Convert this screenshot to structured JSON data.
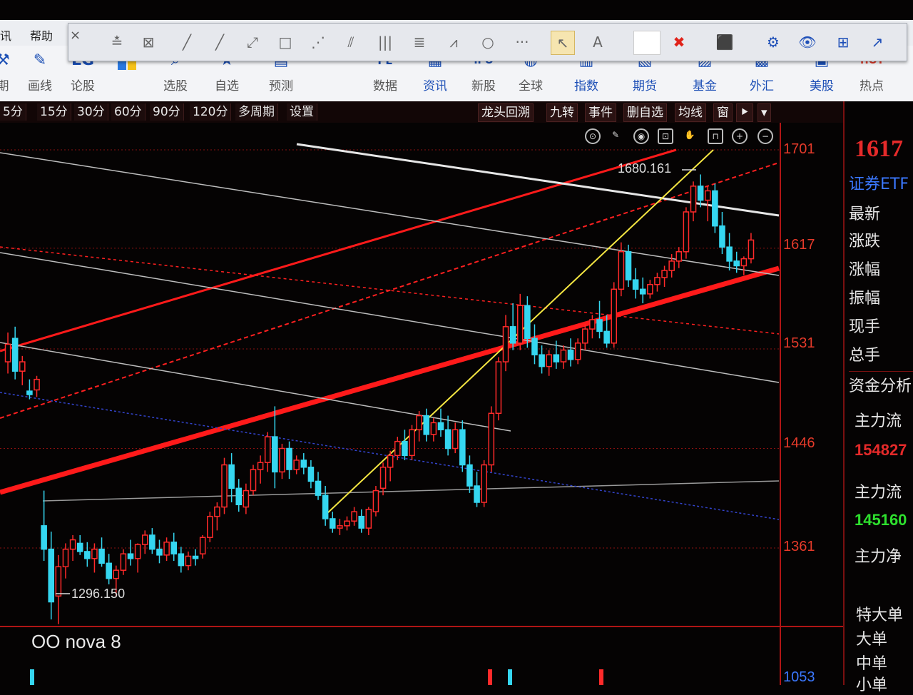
{
  "menubar": {
    "items": [
      "讯",
      "帮助"
    ]
  },
  "toolbar": {
    "buttons": [
      {
        "label": "期",
        "icon": "wrench-icon"
      },
      {
        "label": "画线",
        "icon": "pencil-icon"
      },
      {
        "label": "论股",
        "icon": "lg-logo-icon"
      },
      {
        "label": "",
        "icon": "windows-logo-icon"
      },
      {
        "label": "选股",
        "icon": "magnifier-icon"
      },
      {
        "label": "自选",
        "icon": "star-icon"
      },
      {
        "label": "预测",
        "icon": "forecast-icon"
      },
      {
        "label": "数据",
        "icon": "pe-icon"
      },
      {
        "label": "资讯",
        "icon": "news-icon"
      },
      {
        "label": "新股",
        "icon": "ipo-icon"
      },
      {
        "label": "全球",
        "icon": "globe-icon"
      },
      {
        "label": "指数",
        "icon": "index-icon"
      },
      {
        "label": "期货",
        "icon": "futures-icon"
      },
      {
        "label": "基金",
        "icon": "fund-icon"
      },
      {
        "label": "外汇",
        "icon": "forex-icon"
      },
      {
        "label": "美股",
        "icon": "us-stock-icon"
      },
      {
        "label": "热点",
        "icon": "hot-icon"
      }
    ]
  },
  "drawbar": {
    "close_label": "×",
    "tools": [
      "≛",
      "⊠",
      "╱",
      "╱",
      "⤢",
      "□",
      "⋰",
      "⫽",
      "|||",
      "≣",
      "⩘",
      "○",
      "···"
    ],
    "right_tools": [
      "↖",
      "A",
      "",
      "✖",
      "⬛",
      "⚙",
      "👁",
      "⊞",
      "↗"
    ]
  },
  "periods": [
    "5分",
    "15分",
    "30分",
    "60分",
    "90分",
    "120分",
    "多周期",
    "设置"
  ],
  "right_tools": [
    "龙头回溯",
    "九转",
    "事件",
    "删自选",
    "均线",
    "窗",
    "⯈",
    "▾"
  ],
  "chart_icons": [
    "⊙",
    "✎",
    "◉",
    "⊡",
    "✋",
    "⊓",
    "+",
    "−"
  ],
  "price_axis": [
    "1701",
    "1617",
    "1531",
    "1446",
    "1361",
    "1053"
  ],
  "annotations": {
    "high": "1680.161",
    "low": "1296.150"
  },
  "right_panel": {
    "price": "1617",
    "name": "证券ETF",
    "rows": [
      "最新",
      "涨跌",
      "涨幅",
      "振幅",
      "现手",
      "总手"
    ],
    "section": "资金分析",
    "flow1_label": "主力流",
    "flow1_value": "154827",
    "flow2_label": "主力流",
    "flow2_value": "145160",
    "flow3_label": "主力净",
    "orders": [
      "特大单",
      "大单",
      "中单",
      "小单"
    ]
  },
  "watermark": "OO nova 8",
  "colors": {
    "up": "#ff2a2a",
    "down": "#35d6f0",
    "trend": "#ff1a1a",
    "yellow": "#f5e642"
  },
  "chart_data": {
    "type": "candlestick",
    "ylim": [
      1040,
      1715
    ],
    "candles": [
      [
        1520,
        1545,
        1510,
        1535
      ],
      [
        1540,
        1550,
        1505,
        1512
      ],
      [
        1512,
        1525,
        1500,
        1520
      ],
      [
        1495,
        1505,
        1488,
        1492
      ],
      [
        1496,
        1508,
        1490,
        1505
      ],
      [
        1380,
        1410,
        1350,
        1360
      ],
      [
        1360,
        1375,
        1300,
        1315
      ],
      [
        1320,
        1355,
        1296,
        1345
      ],
      [
        1345,
        1365,
        1335,
        1360
      ],
      [
        1360,
        1372,
        1350,
        1368
      ],
      [
        1365,
        1372,
        1355,
        1358
      ],
      [
        1358,
        1366,
        1345,
        1352
      ],
      [
        1352,
        1365,
        1340,
        1360
      ],
      [
        1360,
        1370,
        1345,
        1348
      ],
      [
        1348,
        1356,
        1330,
        1335
      ],
      [
        1335,
        1346,
        1320,
        1342
      ],
      [
        1342,
        1360,
        1338,
        1356
      ],
      [
        1356,
        1368,
        1346,
        1352
      ],
      [
        1352,
        1365,
        1340,
        1364
      ],
      [
        1364,
        1376,
        1356,
        1372
      ],
      [
        1372,
        1378,
        1356,
        1360
      ],
      [
        1360,
        1368,
        1348,
        1355
      ],
      [
        1355,
        1370,
        1350,
        1366
      ],
      [
        1366,
        1374,
        1350,
        1356
      ],
      [
        1356,
        1362,
        1340,
        1346
      ],
      [
        1346,
        1358,
        1342,
        1354
      ],
      [
        1354,
        1360,
        1346,
        1352
      ],
      [
        1356,
        1372,
        1352,
        1370
      ],
      [
        1370,
        1392,
        1366,
        1388
      ],
      [
        1388,
        1400,
        1376,
        1396
      ],
      [
        1396,
        1438,
        1390,
        1432
      ],
      [
        1432,
        1442,
        1400,
        1412
      ],
      [
        1412,
        1420,
        1392,
        1398
      ],
      [
        1396,
        1416,
        1390,
        1410
      ],
      [
        1410,
        1432,
        1406,
        1428
      ],
      [
        1428,
        1440,
        1416,
        1434
      ],
      [
        1434,
        1460,
        1426,
        1456
      ],
      [
        1456,
        1482,
        1412,
        1426
      ],
      [
        1426,
        1450,
        1420,
        1446
      ],
      [
        1446,
        1452,
        1420,
        1428
      ],
      [
        1428,
        1440,
        1424,
        1436
      ],
      [
        1436,
        1442,
        1424,
        1430
      ],
      [
        1430,
        1436,
        1412,
        1418
      ],
      [
        1418,
        1426,
        1402,
        1406
      ],
      [
        1406,
        1414,
        1380,
        1386
      ],
      [
        1386,
        1392,
        1374,
        1378
      ],
      [
        1378,
        1386,
        1372,
        1380
      ],
      [
        1380,
        1388,
        1376,
        1384
      ],
      [
        1384,
        1396,
        1380,
        1392
      ],
      [
        1388,
        1394,
        1374,
        1378
      ],
      [
        1378,
        1396,
        1372,
        1394
      ],
      [
        1392,
        1414,
        1388,
        1410
      ],
      [
        1412,
        1434,
        1406,
        1430
      ],
      [
        1430,
        1444,
        1418,
        1440
      ],
      [
        1440,
        1456,
        1436,
        1452
      ],
      [
        1452,
        1462,
        1436,
        1440
      ],
      [
        1440,
        1466,
        1436,
        1462
      ],
      [
        1462,
        1478,
        1452,
        1474
      ],
      [
        1474,
        1480,
        1452,
        1458
      ],
      [
        1458,
        1472,
        1452,
        1468
      ],
      [
        1468,
        1480,
        1456,
        1462
      ],
      [
        1462,
        1474,
        1440,
        1446
      ],
      [
        1446,
        1468,
        1442,
        1462
      ],
      [
        1462,
        1470,
        1426,
        1432
      ],
      [
        1432,
        1440,
        1408,
        1414
      ],
      [
        1414,
        1426,
        1396,
        1400
      ],
      [
        1400,
        1436,
        1396,
        1432
      ],
      [
        1432,
        1482,
        1426,
        1476
      ],
      [
        1476,
        1524,
        1470,
        1520
      ],
      [
        1520,
        1560,
        1512,
        1550
      ],
      [
        1550,
        1570,
        1530,
        1536
      ],
      [
        1536,
        1578,
        1530,
        1568
      ],
      [
        1568,
        1576,
        1532,
        1540
      ],
      [
        1540,
        1552,
        1518,
        1526
      ],
      [
        1526,
        1534,
        1510,
        1516
      ],
      [
        1516,
        1530,
        1508,
        1526
      ],
      [
        1526,
        1538,
        1514,
        1520
      ],
      [
        1520,
        1534,
        1514,
        1530
      ],
      [
        1530,
        1540,
        1516,
        1522
      ],
      [
        1522,
        1540,
        1518,
        1536
      ],
      [
        1536,
        1552,
        1530,
        1548
      ],
      [
        1548,
        1560,
        1540,
        1556
      ],
      [
        1556,
        1572,
        1540,
        1546
      ],
      [
        1546,
        1560,
        1532,
        1536
      ],
      [
        1536,
        1588,
        1532,
        1582
      ],
      [
        1582,
        1622,
        1576,
        1614
      ],
      [
        1614,
        1620,
        1584,
        1590
      ],
      [
        1590,
        1600,
        1574,
        1582
      ],
      [
        1582,
        1592,
        1570,
        1578
      ],
      [
        1578,
        1590,
        1574,
        1586
      ],
      [
        1586,
        1596,
        1580,
        1592
      ],
      [
        1592,
        1602,
        1584,
        1598
      ],
      [
        1598,
        1612,
        1592,
        1606
      ],
      [
        1606,
        1618,
        1600,
        1614
      ],
      [
        1614,
        1652,
        1608,
        1648
      ],
      [
        1648,
        1674,
        1640,
        1670
      ],
      [
        1670,
        1680,
        1652,
        1658
      ],
      [
        1658,
        1670,
        1640,
        1666
      ],
      [
        1666,
        1672,
        1630,
        1636
      ],
      [
        1636,
        1648,
        1612,
        1618
      ],
      [
        1618,
        1630,
        1598,
        1606
      ],
      [
        1606,
        1614,
        1596,
        1602
      ],
      [
        1602,
        1610,
        1594,
        1608
      ],
      [
        1608,
        1630,
        1604,
        1624
      ]
    ]
  }
}
